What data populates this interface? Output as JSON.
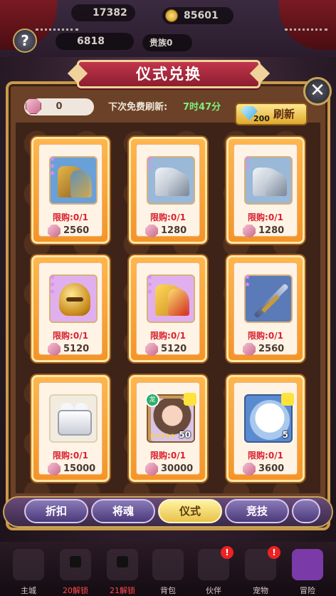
{
  "hud": {
    "stat1": "17382",
    "gold": "85601",
    "power": "6818",
    "rank": "贵族0"
  },
  "title": "仪式兑换",
  "currency": {
    "value": "0"
  },
  "refresh": {
    "label": "下次免费刷新:",
    "time": "7时47分",
    "button_label": "刷新",
    "cost": "200"
  },
  "items": [
    {
      "icon": "gold-boots-icon",
      "limit": "限购:0/1",
      "price": "2560"
    },
    {
      "icon": "silver-boots-icon",
      "limit": "限购:0/1",
      "price": "1280"
    },
    {
      "icon": "silver-boots-icon",
      "limit": "限购:0/1",
      "price": "1280"
    },
    {
      "icon": "gold-helmet-icon",
      "limit": "限购:0/1",
      "price": "5120"
    },
    {
      "icon": "gold-boots-icon",
      "limit": "限购:0/1",
      "price": "5120"
    },
    {
      "icon": "sword-icon",
      "limit": "限购:0/1",
      "price": "2560"
    },
    {
      "icon": "silver-chest-icon",
      "limit": "限购:0/1",
      "price": "15000"
    },
    {
      "icon": "hero-portrait-icon",
      "limit": "限购:0/1",
      "price": "30000",
      "badge": "50",
      "element": "龙"
    },
    {
      "icon": "pet-portrait-icon",
      "limit": "限购:0/1",
      "price": "3600",
      "badge": "5"
    }
  ],
  "tabs": [
    {
      "label": "折扣",
      "active": false
    },
    {
      "label": "将魂",
      "active": false
    },
    {
      "label": "仪式",
      "active": true
    },
    {
      "label": "竞技",
      "active": false
    }
  ],
  "nav": [
    {
      "label": "主城"
    },
    {
      "label": "20解锁"
    },
    {
      "label": "21解锁"
    },
    {
      "label": "背包"
    },
    {
      "label": "伙伴"
    },
    {
      "label": "宠物"
    },
    {
      "label": "冒险"
    }
  ],
  "colors": {
    "card_orange": "#f59428",
    "limit_red": "#d8222f",
    "timer_green": "#7df07a",
    "banner_red": "#c2354a"
  }
}
